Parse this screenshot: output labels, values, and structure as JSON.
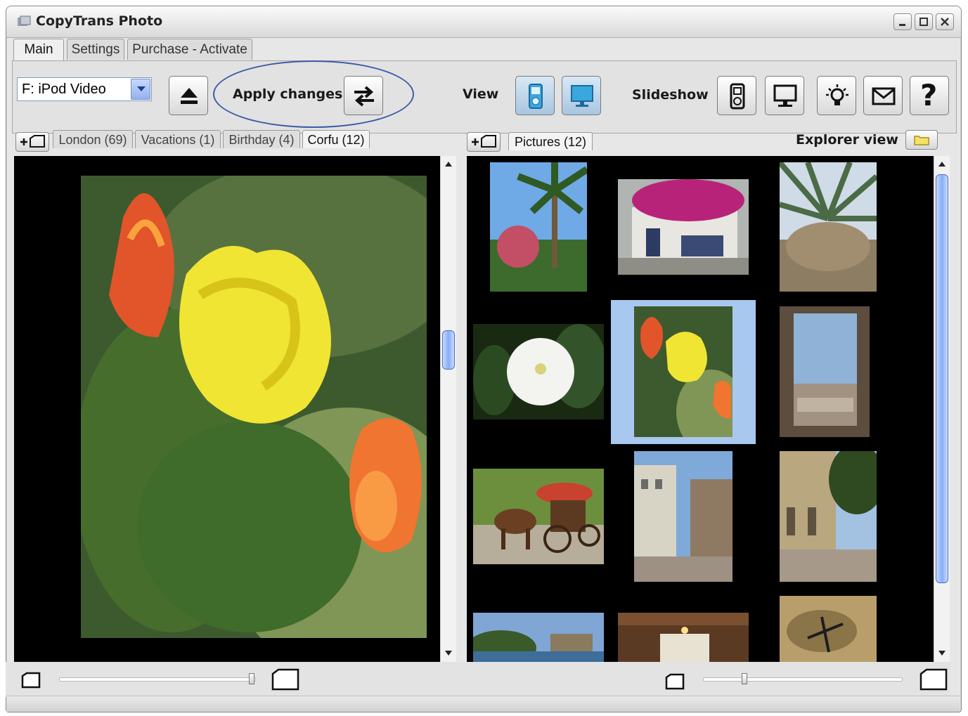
{
  "window": {
    "title": "CopyTrans Photo"
  },
  "tabs": [
    {
      "label": "Main",
      "active": true
    },
    {
      "label": "Settings",
      "active": false
    },
    {
      "label": "Purchase - Activate",
      "active": false
    }
  ],
  "toolbar": {
    "device": "F: iPod Video",
    "apply_changes": "Apply changes",
    "view_label": "View",
    "slideshow_label": "Slideshow",
    "help_glyph": "?"
  },
  "left_albums": [
    {
      "label": "London (69)",
      "active": false
    },
    {
      "label": "Vacations (1)",
      "active": false
    },
    {
      "label": "Birthday (4)",
      "active": false
    },
    {
      "label": "Corfu (12)",
      "active": true
    }
  ],
  "right_albums": [
    {
      "label": "Pictures (12)",
      "active": true
    }
  ],
  "explorer_view_label": "Explorer view",
  "zoom": {
    "left": 1.0,
    "right": 0.2
  },
  "colors": {
    "accent": "#3b5ba8",
    "selection": "#a9c8ef",
    "pane": "#000000"
  },
  "icons": [
    "app-icon",
    "minimize-icon",
    "maximize-icon",
    "close-icon",
    "eject-icon",
    "sync-arrows-icon",
    "ipod-view-icon",
    "computer-view-icon",
    "ipod-slideshow-icon",
    "computer-slideshow-icon",
    "lightbulb-icon",
    "mail-icon",
    "help-icon",
    "add-album-icon",
    "folder-icon",
    "small-page-icon",
    "large-page-icon"
  ]
}
